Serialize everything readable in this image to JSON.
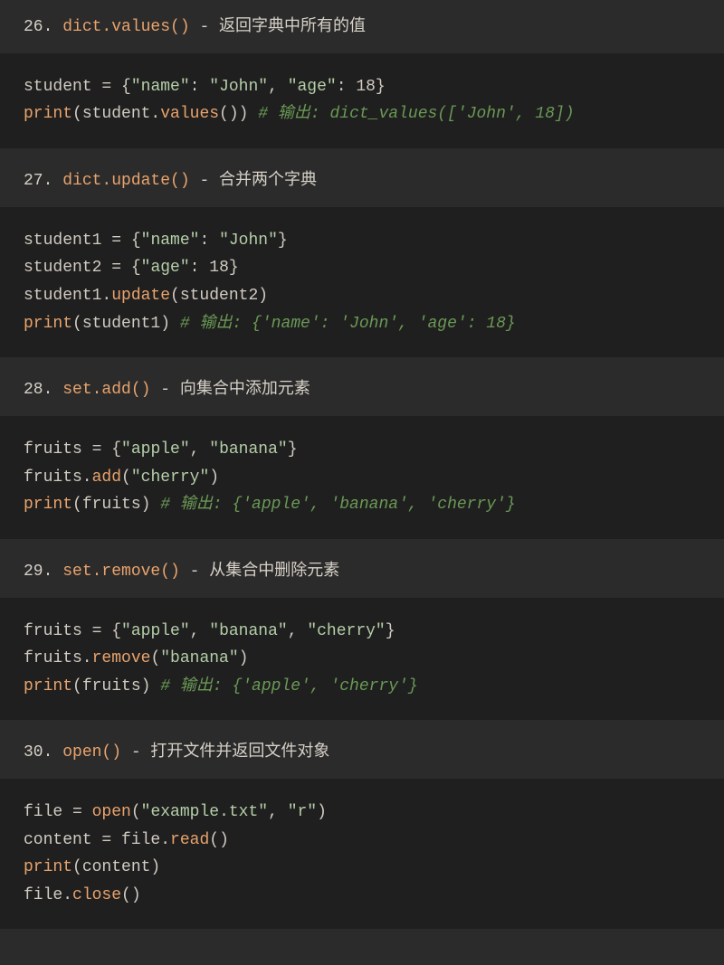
{
  "items": [
    {
      "num": "26. ",
      "fn": "dict.values()",
      "desc": " - 返回字典中所有的值",
      "code": [
        [
          {
            "t": "student ",
            "c": "c-plain"
          },
          {
            "t": "= ",
            "c": "c-op"
          },
          {
            "t": "{",
            "c": "c-plain"
          },
          {
            "t": "\"name\"",
            "c": "c-str"
          },
          {
            "t": ": ",
            "c": "c-plain"
          },
          {
            "t": "\"John\"",
            "c": "c-str"
          },
          {
            "t": ", ",
            "c": "c-plain"
          },
          {
            "t": "\"age\"",
            "c": "c-str"
          },
          {
            "t": ": ",
            "c": "c-plain"
          },
          {
            "t": "18",
            "c": "c-num"
          },
          {
            "t": "}",
            "c": "c-plain"
          }
        ],
        [
          {
            "t": "print",
            "c": "c-builtin"
          },
          {
            "t": "(student.",
            "c": "c-plain"
          },
          {
            "t": "values",
            "c": "c-func"
          },
          {
            "t": "()) ",
            "c": "c-plain"
          },
          {
            "t": "# 输出: dict_values(['John', 18])",
            "c": "c-comment"
          }
        ]
      ]
    },
    {
      "num": "27. ",
      "fn": "dict.update()",
      "desc": " - 合并两个字典",
      "code": [
        [
          {
            "t": "student1 ",
            "c": "c-plain"
          },
          {
            "t": "= ",
            "c": "c-op"
          },
          {
            "t": "{",
            "c": "c-plain"
          },
          {
            "t": "\"name\"",
            "c": "c-str"
          },
          {
            "t": ": ",
            "c": "c-plain"
          },
          {
            "t": "\"John\"",
            "c": "c-str"
          },
          {
            "t": "}",
            "c": "c-plain"
          }
        ],
        [
          {
            "t": "student2 ",
            "c": "c-plain"
          },
          {
            "t": "= ",
            "c": "c-op"
          },
          {
            "t": "{",
            "c": "c-plain"
          },
          {
            "t": "\"age\"",
            "c": "c-str"
          },
          {
            "t": ": ",
            "c": "c-plain"
          },
          {
            "t": "18",
            "c": "c-num"
          },
          {
            "t": "}",
            "c": "c-plain"
          }
        ],
        [
          {
            "t": "student1.",
            "c": "c-plain"
          },
          {
            "t": "update",
            "c": "c-func"
          },
          {
            "t": "(student2)",
            "c": "c-plain"
          }
        ],
        [
          {
            "t": "print",
            "c": "c-builtin"
          },
          {
            "t": "(student1) ",
            "c": "c-plain"
          },
          {
            "t": "# 输出: {'name': 'John', 'age': 18}",
            "c": "c-comment"
          }
        ]
      ]
    },
    {
      "num": "28. ",
      "fn": "set.add()",
      "desc": " - 向集合中添加元素",
      "code": [
        [
          {
            "t": "fruits ",
            "c": "c-plain"
          },
          {
            "t": "= ",
            "c": "c-op"
          },
          {
            "t": "{",
            "c": "c-plain"
          },
          {
            "t": "\"apple\"",
            "c": "c-str"
          },
          {
            "t": ", ",
            "c": "c-plain"
          },
          {
            "t": "\"banana\"",
            "c": "c-str"
          },
          {
            "t": "}",
            "c": "c-plain"
          }
        ],
        [
          {
            "t": "fruits.",
            "c": "c-plain"
          },
          {
            "t": "add",
            "c": "c-func"
          },
          {
            "t": "(",
            "c": "c-plain"
          },
          {
            "t": "\"cherry\"",
            "c": "c-str"
          },
          {
            "t": ")",
            "c": "c-plain"
          }
        ],
        [
          {
            "t": "print",
            "c": "c-builtin"
          },
          {
            "t": "(fruits) ",
            "c": "c-plain"
          },
          {
            "t": "# 输出: {'apple', 'banana', 'cherry'}",
            "c": "c-comment"
          }
        ]
      ]
    },
    {
      "num": "29. ",
      "fn": "set.remove()",
      "desc": " - 从集合中删除元素",
      "code": [
        [
          {
            "t": "fruits ",
            "c": "c-plain"
          },
          {
            "t": "= ",
            "c": "c-op"
          },
          {
            "t": "{",
            "c": "c-plain"
          },
          {
            "t": "\"apple\"",
            "c": "c-str"
          },
          {
            "t": ", ",
            "c": "c-plain"
          },
          {
            "t": "\"banana\"",
            "c": "c-str"
          },
          {
            "t": ", ",
            "c": "c-plain"
          },
          {
            "t": "\"cherry\"",
            "c": "c-str"
          },
          {
            "t": "}",
            "c": "c-plain"
          }
        ],
        [
          {
            "t": "fruits.",
            "c": "c-plain"
          },
          {
            "t": "remove",
            "c": "c-func"
          },
          {
            "t": "(",
            "c": "c-plain"
          },
          {
            "t": "\"banana\"",
            "c": "c-str"
          },
          {
            "t": ")",
            "c": "c-plain"
          }
        ],
        [
          {
            "t": "print",
            "c": "c-builtin"
          },
          {
            "t": "(fruits) ",
            "c": "c-plain"
          },
          {
            "t": "# 输出: {'apple', 'cherry'}",
            "c": "c-comment"
          }
        ]
      ]
    },
    {
      "num": "30. ",
      "fn": "open()",
      "desc": " - 打开文件并返回文件对象",
      "code": [
        [
          {
            "t": "file ",
            "c": "c-plain"
          },
          {
            "t": "= ",
            "c": "c-op"
          },
          {
            "t": "open",
            "c": "c-builtin"
          },
          {
            "t": "(",
            "c": "c-plain"
          },
          {
            "t": "\"example.txt\"",
            "c": "c-str"
          },
          {
            "t": ", ",
            "c": "c-plain"
          },
          {
            "t": "\"r\"",
            "c": "c-str"
          },
          {
            "t": ")",
            "c": "c-plain"
          }
        ],
        [
          {
            "t": "content ",
            "c": "c-plain"
          },
          {
            "t": "= ",
            "c": "c-op"
          },
          {
            "t": "file.",
            "c": "c-plain"
          },
          {
            "t": "read",
            "c": "c-func"
          },
          {
            "t": "()",
            "c": "c-plain"
          }
        ],
        [
          {
            "t": "print",
            "c": "c-builtin"
          },
          {
            "t": "(content)",
            "c": "c-plain"
          }
        ],
        [
          {
            "t": "file.",
            "c": "c-plain"
          },
          {
            "t": "close",
            "c": "c-func"
          },
          {
            "t": "()",
            "c": "c-plain"
          }
        ]
      ]
    }
  ]
}
